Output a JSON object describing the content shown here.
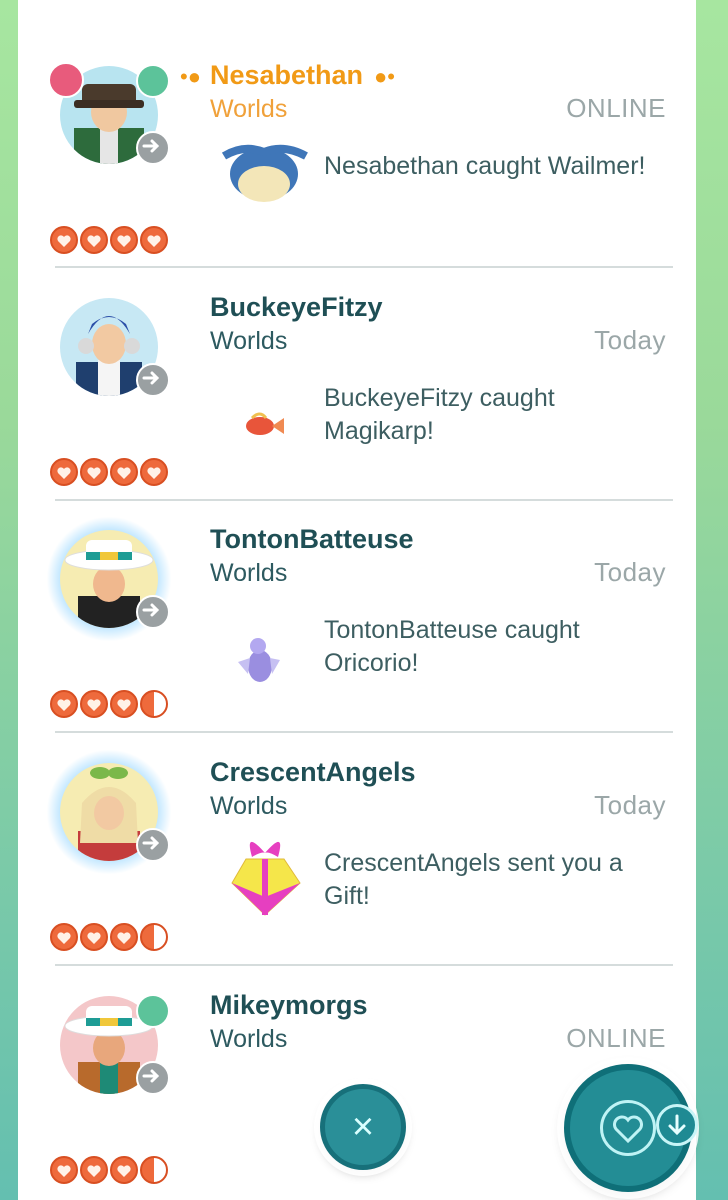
{
  "friends": [
    {
      "name": "Nesabethan",
      "subtitle": "Worlds",
      "status": "ONLINE",
      "message": "Nesabethan caught Wailmer!",
      "thumb": "wailmer-icon",
      "hearts": 4,
      "online": true,
      "lucky": true,
      "team_badge": true
    },
    {
      "name": "BuckeyeFitzy",
      "subtitle": "Worlds",
      "status": "Today",
      "message": "BuckeyeFitzy caught Magikarp!",
      "thumb": "magikarp-icon",
      "hearts": 4,
      "online": false
    },
    {
      "name": "TontonBatteuse",
      "subtitle": "Worlds",
      "status": "Today",
      "message": "TontonBatteuse caught Oricorio!",
      "thumb": "oricorio-icon",
      "hearts": 3.5,
      "online": false
    },
    {
      "name": "CrescentAngels",
      "subtitle": "Worlds",
      "status": "Today",
      "message": "CrescentAngels sent you a Gift!",
      "thumb": "gift-icon",
      "hearts": 3.5,
      "online": false
    },
    {
      "name": "Mikeymorgs",
      "subtitle": "Worlds",
      "status": "ONLINE",
      "message": "",
      "thumb": "",
      "hearts": 3.5,
      "online": true
    }
  ],
  "colors": {
    "accent": "#1f4f55",
    "lucky": "#f19a16",
    "online": "#5cc39a",
    "heart": "#ee6a3c",
    "fab": "#238d95"
  },
  "icons": {
    "close": "close-icon",
    "heart": "heart-icon",
    "download": "arrow-down-icon",
    "arrow": "arrow-right-icon"
  }
}
